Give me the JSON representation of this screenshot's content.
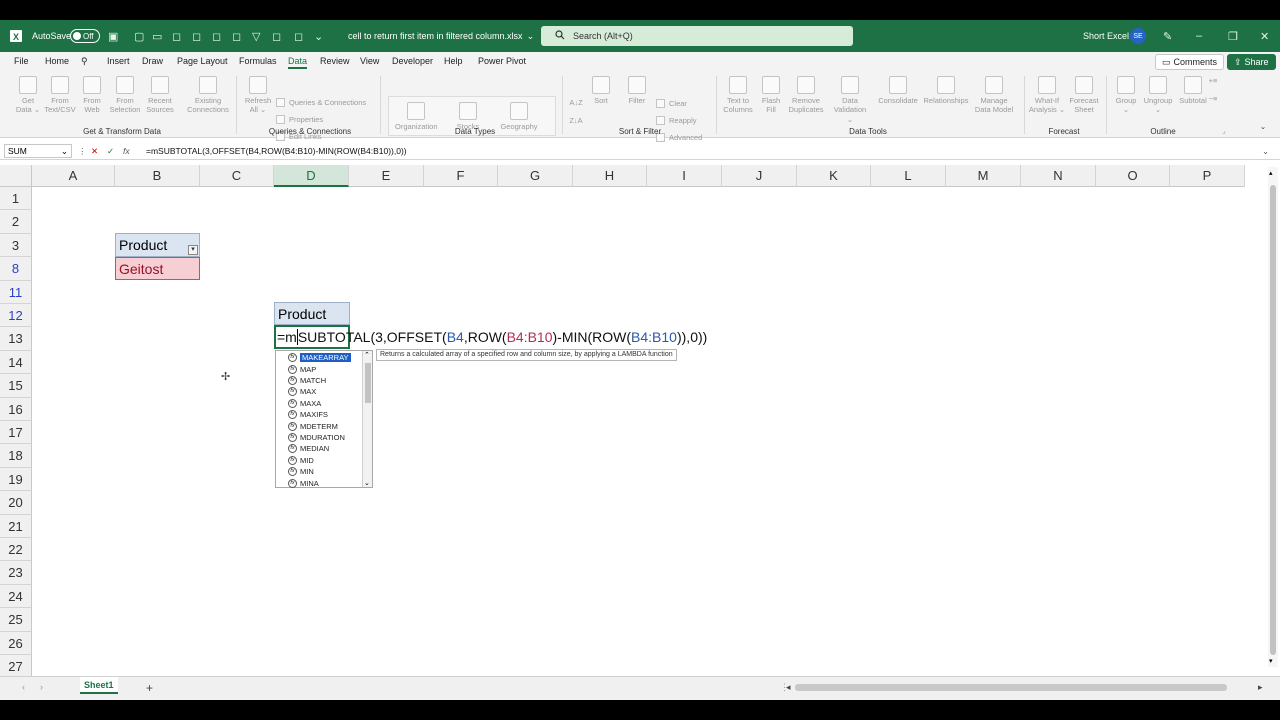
{
  "titlebar": {
    "autosave_label": "AutoSave",
    "autosave_state": "Off",
    "file_name": "cell to return first item in filtered column.xlsx",
    "file_chevron": "⌄",
    "search_placeholder": "Search (Alt+Q)",
    "user_name": "Short Excel",
    "user_initials": "SE"
  },
  "menu": {
    "tabs": [
      "File",
      "Home",
      "Insert",
      "Draw",
      "Page Layout",
      "Formulas",
      "Data",
      "Review",
      "View",
      "Developer",
      "Help",
      "Power Pivot"
    ],
    "active_tab": "Data",
    "comments_label": "Comments",
    "share_label": "Share"
  },
  "ribbon": {
    "get_transform": {
      "items": [
        "Get\nData ⌄",
        "From\nText/CSV",
        "From\nWeb",
        "From\nSelection",
        "Recent\nSources",
        "Existing\nConnections"
      ],
      "label": "Get & Transform Data"
    },
    "queries": {
      "refresh": "Refresh\nAll ⌄",
      "rows": [
        "Queries & Connections",
        "Properties",
        "Edit Links"
      ],
      "label": "Queries & Connections"
    },
    "data_types": {
      "items": [
        "Organization",
        "Stocks",
        "Geography"
      ],
      "label": "Data Types"
    },
    "sort_filter": {
      "sort": "Sort",
      "filter": "Filter",
      "rows": [
        "Clear",
        "Reapply",
        "Advanced"
      ],
      "label": "Sort & Filter"
    },
    "data_tools": {
      "items": [
        "Text to\nColumns",
        "Flash\nFill",
        "Remove\nDuplicates",
        "Data\nValidation ⌄",
        "Consolidate",
        "Relationships",
        "Manage\nData Model"
      ],
      "label": "Data Tools"
    },
    "forecast": {
      "items": [
        "What-If\nAnalysis ⌄",
        "Forecast\nSheet"
      ],
      "label": "Forecast"
    },
    "outline": {
      "items": [
        "Group\n⌄",
        "Ungroup\n⌄",
        "Subtotal"
      ],
      "label": "Outline"
    }
  },
  "formula_bar": {
    "name_box": "SUM",
    "cancel_symbol": "✕",
    "enter_symbol": "✓",
    "fx_label": "fx",
    "content": "=mSUBTOTAL(3,OFFSET(B4,ROW(B4:B10)-MIN(ROW(B4:B10)),0))"
  },
  "grid": {
    "columns": [
      "A",
      "B",
      "C",
      "D",
      "E",
      "F",
      "G",
      "H",
      "I",
      "J",
      "K",
      "L",
      "M",
      "N",
      "O",
      "P"
    ],
    "selected_column": "D",
    "rows": [
      "1",
      "2",
      "3",
      "8",
      "11",
      "12",
      "13",
      "14",
      "15",
      "16",
      "17",
      "18",
      "19",
      "20",
      "21",
      "22",
      "23",
      "24",
      "25",
      "26",
      "27"
    ],
    "filtered_rows": [
      "8",
      "11",
      "12"
    ],
    "b3": "Product",
    "b8": "Geitost",
    "d11": "Product",
    "filter_icon_glyph": "▾"
  },
  "formula_edit": {
    "prefix": "=m",
    "fn1": "SUBTOTAL(3,OFFSET(",
    "ref1": "B4",
    "sep1": ",ROW(",
    "ref2": "B4:B10",
    "mid": ")-MIN(ROW(",
    "ref3": "B4:B10",
    "suffix": ")),0))"
  },
  "autocomplete": {
    "items": [
      "MAKEARRAY",
      "MAP",
      "MATCH",
      "MAX",
      "MAXA",
      "MAXIFS",
      "MDETERM",
      "MDURATION",
      "MEDIAN",
      "MID",
      "MIN",
      "MINA"
    ],
    "selected": "MAKEARRAY",
    "tooltip": "Returns a calculated array of a specified row and column size, by applying a LAMBDA function"
  },
  "sheets": {
    "tabs": [
      "Sheet1"
    ],
    "add_symbol": "+"
  },
  "colors": {
    "excel_green": "#1e7145",
    "header_fill": "#dbe5f1",
    "highlight_fill": "#f6cfd4",
    "ref_blue": "#2b5aa8",
    "ref_red": "#b03050"
  }
}
